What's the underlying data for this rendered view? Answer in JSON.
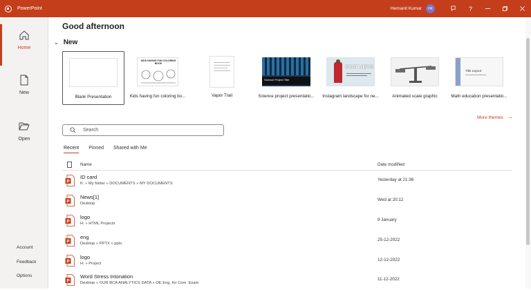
{
  "app": {
    "title": "PowerPoint",
    "user_name": "Hemanit Kumar",
    "user_initials": "HK",
    "accent": "#c43e1c"
  },
  "sidebar": {
    "items": [
      {
        "label": "Home",
        "icon": "home-icon"
      },
      {
        "label": "New",
        "icon": "new-file-icon"
      },
      {
        "label": "Open",
        "icon": "folder-open-icon"
      }
    ],
    "bottom": [
      "Account",
      "Feedback",
      "Options"
    ]
  },
  "main": {
    "greeting": "Good afternoon",
    "new_section": "New",
    "templates": [
      {
        "label": "Blank Presentation"
      },
      {
        "label": "Kids having fun coloring bo...",
        "thumb_title": "KIDS HAVING FUN COLORING BOOK"
      },
      {
        "label": "Vapor Trail"
      },
      {
        "label": "Science project presentatio...",
        "thumb_title": "Science Project Title"
      },
      {
        "label": "Instagram landscape for ne...",
        "thumb_title": "BEAT NEWS"
      },
      {
        "label": "Animated scale graphic"
      },
      {
        "label": "Math education presentatio...",
        "thumb_title": "Title Layout"
      }
    ],
    "more_themes": "More themes",
    "search_placeholder": "Search",
    "tabs": [
      "Recent",
      "Pinned",
      "Shared with Me"
    ],
    "columns": {
      "name": "Name",
      "date": "Date modified"
    },
    "files": [
      {
        "name": "ID card",
        "path": "K: » My folder » DOCUMENTS » MY DOCUMENTS",
        "date": "Yesterday at 21:36"
      },
      {
        "name": "News[1]",
        "path": "Desktop",
        "date": "Wed at 20:12"
      },
      {
        "name": "logo",
        "path": "H: » HTML Projects",
        "date": "9 January"
      },
      {
        "name": "eng",
        "path": "Desktop » PPTX » pptx",
        "date": "25-12-2022"
      },
      {
        "name": "logo",
        "path": "H: » Project",
        "date": "12-12-2022"
      },
      {
        "name": "Word Stress  Intonation",
        "path": "Desktop » OUR BCA ANALYTICS DATA » OE Eng. for Com. Exam",
        "date": "11-12-2022"
      }
    ]
  }
}
